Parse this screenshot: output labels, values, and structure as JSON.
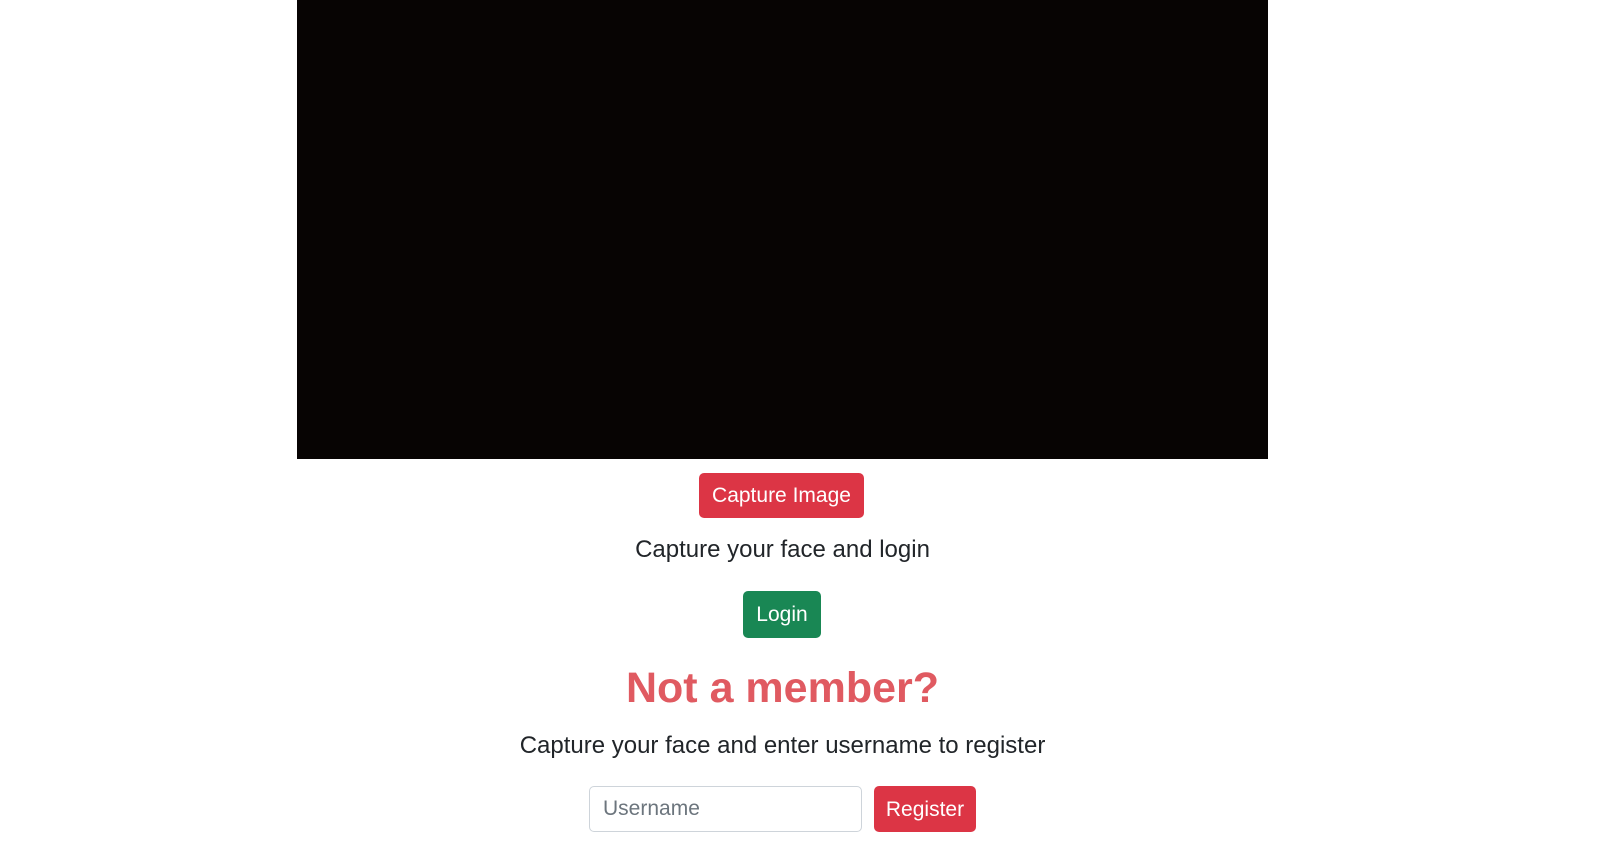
{
  "capture": {
    "button_label": "Capture Image"
  },
  "login": {
    "instruction": "Capture your face and login",
    "button_label": "Login"
  },
  "register": {
    "heading": "Not a member?",
    "instruction": "Capture your face and enter username to register",
    "username_value": "",
    "username_placeholder": "Username",
    "button_label": "Register"
  },
  "colors": {
    "danger": "#dc3545",
    "success": "#198754",
    "heading_red": "#e05a61",
    "video_background": "#070403"
  }
}
